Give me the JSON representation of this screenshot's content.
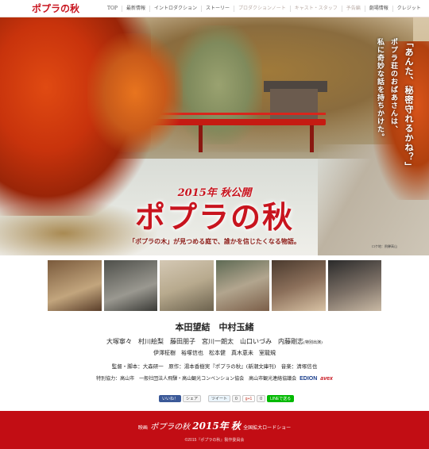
{
  "nav": {
    "logo": "ポプラの秋",
    "items": [
      {
        "label": "TOP",
        "dim": false
      },
      {
        "label": "最新情報",
        "dim": false
      },
      {
        "label": "イントロダクション",
        "dim": false
      },
      {
        "label": "ストーリー",
        "dim": false
      },
      {
        "label": "プロダクションノート",
        "dim": true
      },
      {
        "label": "キャスト・スタッフ",
        "dim": true
      },
      {
        "label": "予告編",
        "dim": true
      },
      {
        "label": "劇場情報",
        "dim": false
      },
      {
        "label": "クレジット",
        "dim": false
      }
    ]
  },
  "hero": {
    "catch_lines": [
      "「あんた、秘密守れるかね？」",
      "ポプラ荘のおばあさんは、",
      "私に奇妙な話を持ちかけた。"
    ],
    "year": "2015年",
    "release": "秋公開",
    "title": "ポプラの秋",
    "tagline": "「ポプラの木」が見つめる庭で、誰かを信じたくなる物語。",
    "location": "ロケ地：飛騨高山"
  },
  "cast": {
    "lead": "本田望結　中村玉緒",
    "supporting": "大塚寧々　村川絵梨　藤田朋子　宮川一朗太　山口いづみ　内藤剛志",
    "supporting_note": "(特別出演)",
    "minor": "伊澤柾樹　裕塚信也　松本健　真木恵未　室龍規"
  },
  "credits": {
    "line1": "監督・脚本：大森研一　原作：湯本香樹実『ポプラの秋』(新潮文庫刊)　音楽：清塚信也",
    "line2": "特別協力：高山市　一般社団法人飛騨・高山観光コンベンション協会　高山市観光連絡協議会",
    "logo1": "EDION",
    "logo2": "avex"
  },
  "social": {
    "left": [
      {
        "name": "facebook-like-button",
        "label": "いいね！",
        "type": "fb"
      },
      {
        "name": "facebook-share-button",
        "label": "シェア",
        "type": "plain"
      }
    ],
    "right": [
      {
        "name": "tweet-button",
        "label": "ツイート",
        "type": "tw"
      },
      {
        "name": "tweet-count",
        "label": "0",
        "type": "plain"
      },
      {
        "name": "google-plus-button",
        "label": "g+1",
        "type": "g"
      },
      {
        "name": "google-plus-count",
        "label": "0",
        "type": "plain"
      },
      {
        "name": "line-button",
        "label": "LINEで送る",
        "type": "line"
      }
    ]
  },
  "footer": {
    "prefix": "映画",
    "title": "ポプラの秋",
    "year": "2015年",
    "season": "秋",
    "release": "全国拡大ロードショー",
    "copyright": "©2015『ポプラの秋』製作委員会"
  }
}
